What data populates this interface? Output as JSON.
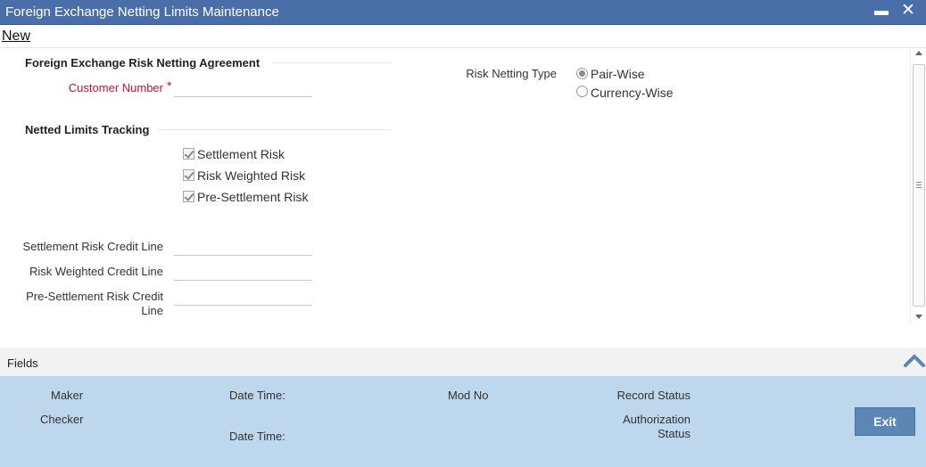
{
  "window": {
    "title": "Foreign Exchange Netting Limits Maintenance"
  },
  "toolbar": {
    "new_label": "New"
  },
  "agreement": {
    "section_title": "Foreign Exchange Risk Netting Agreement",
    "customer_number_label": "Customer Number",
    "customer_number_value": "",
    "required_marker": "*"
  },
  "risk_netting_type": {
    "label": "Risk Netting Type",
    "options": [
      {
        "label": "Pair-Wise",
        "selected": true
      },
      {
        "label": "Currency-Wise",
        "selected": false
      }
    ]
  },
  "tracking": {
    "section_title": "Netted Limits Tracking",
    "checkboxes": [
      {
        "label": "Settlement Risk",
        "checked": true
      },
      {
        "label": "Risk Weighted Risk",
        "checked": true
      },
      {
        "label": "Pre-Settlement Risk",
        "checked": true
      }
    ]
  },
  "credit_lines": {
    "settlement_label": "Settlement Risk Credit Line",
    "risk_weighted_label": "Risk Weighted Credit Line",
    "pre_settlement_label_line1": "Pre-Settlement Risk Credit",
    "pre_settlement_label_line2": "Line",
    "settlement_value": "",
    "risk_weighted_value": "",
    "pre_settlement_value": ""
  },
  "fields_bar": {
    "label": "Fields"
  },
  "footer": {
    "maker_label": "Maker",
    "checker_label": "Checker",
    "date_time_label": "Date Time:",
    "date_time_label_2": "Date Time:",
    "mod_no_label": "Mod No",
    "record_status_label": "Record Status",
    "authorization_status_line1": "Authorization",
    "authorization_status_line2": "Status",
    "exit_label": "Exit"
  },
  "colors": {
    "titlebar": "#4a6fa8",
    "footer": "#bdd7ec",
    "required": "#c8102e",
    "exit_button": "#5b86b5"
  }
}
